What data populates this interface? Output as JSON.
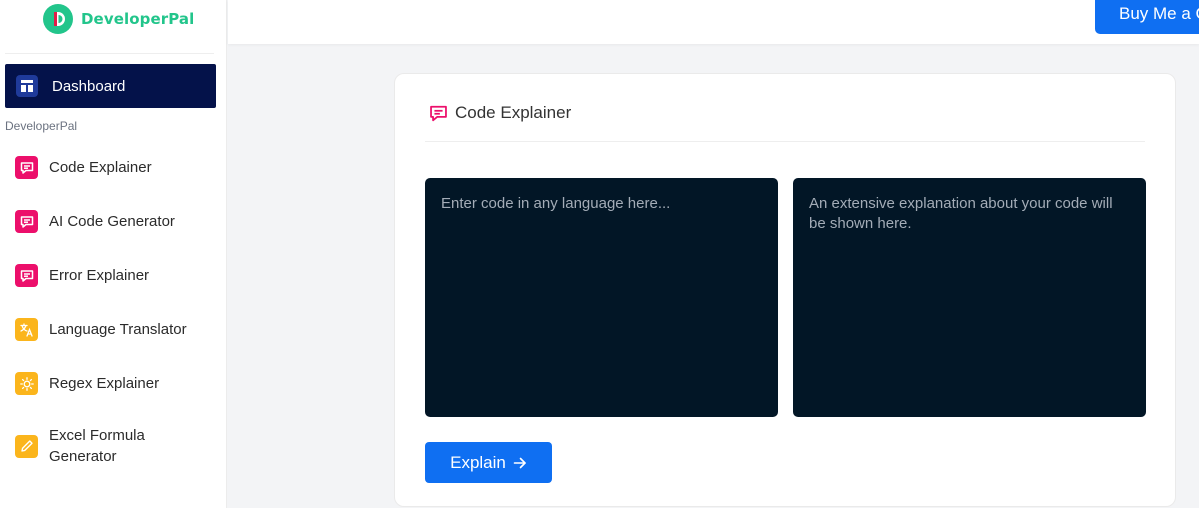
{
  "brand": {
    "name": "DeveloperPal",
    "color": "#22c58b"
  },
  "topbar": {
    "buy_label": "Buy Me a Coffee"
  },
  "sidebar": {
    "dashboard_label": "Dashboard",
    "section_label": "DeveloperPal",
    "items": [
      {
        "label": "Code Explainer",
        "icon": "chat-icon",
        "color": "#ec0f6b"
      },
      {
        "label": "AI Code Generator",
        "icon": "chat-icon",
        "color": "#ec0f6b"
      },
      {
        "label": "Error Explainer",
        "icon": "chat-icon",
        "color": "#ec0f6b"
      },
      {
        "label": "Language Translator",
        "icon": "translate-icon",
        "color": "#fbb51c"
      },
      {
        "label": "Regex Explainer",
        "icon": "lightbulb-icon",
        "color": "#fbb51c"
      },
      {
        "label": "Excel Formula Generator",
        "icon": "pencil-icon",
        "color": "#fbb51c"
      }
    ]
  },
  "main": {
    "card_title": "Code Explainer",
    "input_placeholder": "Enter code in any language here...",
    "output_placeholder": "An extensive explanation about your code will be shown here.",
    "explain_label": "Explain",
    "accent": "#0f6ff2",
    "panel_color": "#021626"
  }
}
